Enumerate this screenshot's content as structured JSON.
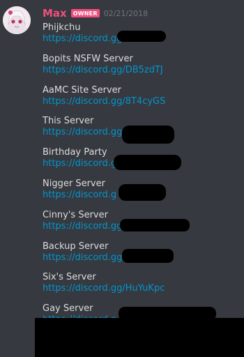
{
  "message": {
    "author": "Max",
    "badge": "OWNER",
    "timestamp": "02/21/2018",
    "author_color": "#f04f7e",
    "link_color": "#0096cf"
  },
  "servers": [
    {
      "name": "Phijkchu",
      "link": "https://discord.gg"
    },
    {
      "name": "Bopits NSFW Server",
      "link": "https://discord.gg/DB5zdTJ"
    },
    {
      "name": "AaMC Site Server",
      "link": "https://discord.gg/8T4cyGS"
    },
    {
      "name": "This Server",
      "link": "https://discord.gg"
    },
    {
      "name": "Birthday Party",
      "link": "https://discord.g"
    },
    {
      "name": "Nigger Server",
      "link": "https://discord.g"
    },
    {
      "name": "Cinny's Server",
      "link": "https://discord.gg"
    },
    {
      "name": "Backup Server",
      "link": "https://discord.gg/"
    },
    {
      "name": "Six's Server",
      "link": "https://discord.gg/HuYuKpc"
    },
    {
      "name": "Gay Server",
      "link": "https://discord.g"
    }
  ]
}
